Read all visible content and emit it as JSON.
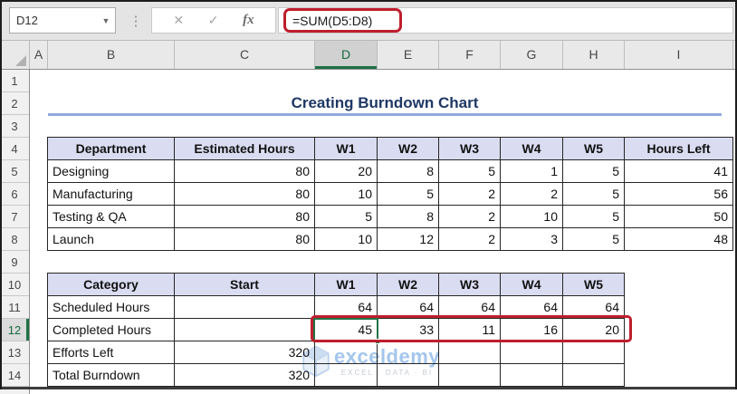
{
  "formula_bar": {
    "name_box_value": "D12",
    "formula": "=SUM(D5:D8)",
    "cancel_icon": "✕",
    "enter_icon": "✓",
    "fx_label": "fx"
  },
  "grid": {
    "column_letters": [
      "A",
      "B",
      "C",
      "D",
      "E",
      "F",
      "G",
      "H",
      "I"
    ],
    "row_numbers": [
      1,
      2,
      3,
      4,
      5,
      6,
      7,
      8,
      9,
      10,
      11,
      12,
      13,
      14
    ],
    "selected_cell": "D12",
    "selected_column": "D",
    "selected_row": 12
  },
  "title": {
    "text": "Creating Burndown Chart"
  },
  "table1": {
    "headers": [
      "Department",
      "Estimated Hours",
      "W1",
      "W2",
      "W3",
      "W4",
      "W5",
      "Hours Left"
    ],
    "rows": [
      [
        "Designing",
        "80",
        "20",
        "8",
        "5",
        "1",
        "5",
        "41"
      ],
      [
        "Manufacturing",
        "80",
        "10",
        "5",
        "2",
        "2",
        "5",
        "56"
      ],
      [
        "Testing & QA",
        "80",
        "5",
        "8",
        "2",
        "10",
        "5",
        "50"
      ],
      [
        "Launch",
        "80",
        "10",
        "12",
        "2",
        "3",
        "5",
        "48"
      ]
    ]
  },
  "table2": {
    "headers": [
      "Category",
      "Start",
      "W1",
      "W2",
      "W3",
      "W4",
      "W5"
    ],
    "rows": [
      [
        "Scheduled Hours",
        "",
        "64",
        "64",
        "64",
        "64",
        "64"
      ],
      [
        "Completed Hours",
        "",
        "45",
        "33",
        "11",
        "16",
        "20"
      ],
      [
        "Efforts Left",
        "320",
        "",
        "",
        "",
        "",
        ""
      ],
      [
        "Total Burndown",
        "320",
        "",
        "",
        "",
        "",
        ""
      ]
    ]
  },
  "watermark": {
    "brand": "exceldemy",
    "tagline": "EXCEL · DATA · BI"
  },
  "colors": {
    "title_navy": "#1F3864",
    "title_underline": "#8FAADC",
    "table_header_fill": "#DADCF1",
    "annotation_red": "#BE1E2D",
    "selection_green": "#217346",
    "watermark_blue": "#A3C6EC"
  }
}
